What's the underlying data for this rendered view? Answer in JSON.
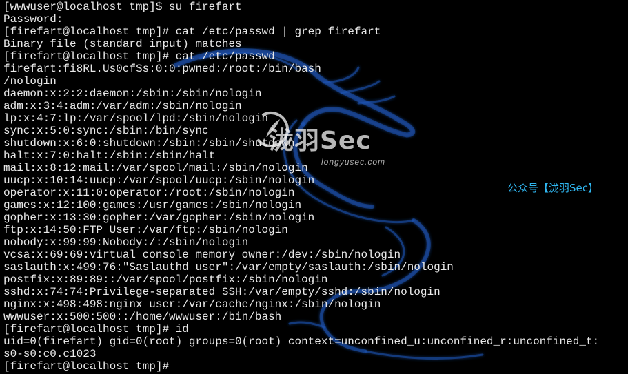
{
  "terminal": {
    "lines": [
      "[wwwuser@localhost tmp]$ su firefart",
      "Password:",
      "[firefart@localhost tmp]# cat /etc/passwd | grep firefart",
      "Binary file (standard input) matches",
      "[firefart@localhost tmp]# cat /etc/passwd",
      "firefart:fi8RL.Us0cfSs:0:0:pwned:/root:/bin/bash",
      "/nologin",
      "daemon:x:2:2:daemon:/sbin:/sbin/nologin",
      "adm:x:3:4:adm:/var/adm:/sbin/nologin",
      "lp:x:4:7:lp:/var/spool/lpd:/sbin/nologin",
      "sync:x:5:0:sync:/sbin:/bin/sync",
      "shutdown:x:6:0:shutdown:/sbin:/sbin/shutdown",
      "halt:x:7:0:halt:/sbin:/sbin/halt",
      "mail:x:8:12:mail:/var/spool/mail:/sbin/nologin",
      "uucp:x:10:14:uucp:/var/spool/uucp:/sbin/nologin",
      "operator:x:11:0:operator:/root:/sbin/nologin",
      "games:x:12:100:games:/usr/games:/sbin/nologin",
      "gopher:x:13:30:gopher:/var/gopher:/sbin/nologin",
      "ftp:x:14:50:FTP User:/var/ftp:/sbin/nologin",
      "nobody:x:99:99:Nobody:/:/sbin/nologin",
      "vcsa:x:69:69:virtual console memory owner:/dev:/sbin/nologin",
      "saslauth:x:499:76:\"Saslauthd user\":/var/empty/saslauth:/sbin/nologin",
      "postfix:x:89:89::/var/spool/postfix:/sbin/nologin",
      "sshd:x:74:74:Privilege-separated SSH:/var/empty/sshd:/sbin/nologin",
      "nginx:x:498:498:nginx user:/var/cache/nginx:/sbin/nologin",
      "wwwuser:x:500:500::/home/wwwuser:/bin/bash",
      "[firefart@localhost tmp]# id",
      "uid=0(firefart) gid=0(root) groups=0(root) context=unconfined_u:unconfined_r:unconfined_t:",
      "s0-s0:c0.c1023",
      "[firefart@localhost tmp]# "
    ]
  },
  "watermark": {
    "logo_icon": "feather-circle-logo-icon",
    "title": "泷羽Sec",
    "url": "longyusec.com",
    "account": "公众号【泷羽Sec】"
  },
  "background_icon": "kali-dragon-icon",
  "colors": {
    "background": "#000000",
    "text": "#e8e8e8",
    "dragon": "#1a4fa8",
    "account_text": "#2fb6f0"
  }
}
